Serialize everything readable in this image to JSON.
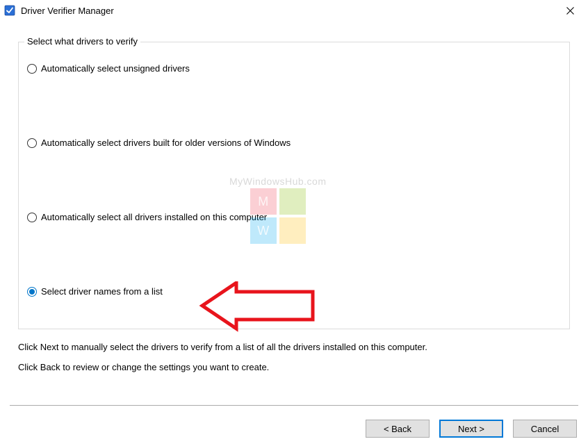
{
  "window": {
    "title": "Driver Verifier Manager"
  },
  "groupbox": {
    "title": "Select what drivers to verify",
    "options": [
      {
        "label": "Automatically select unsigned drivers",
        "selected": false
      },
      {
        "label": "Automatically select drivers built for older versions of Windows",
        "selected": false
      },
      {
        "label": "Automatically select all drivers installed on this computer",
        "selected": false
      },
      {
        "label": "Select driver names from a list",
        "selected": true
      }
    ]
  },
  "help": {
    "line1": "Click Next to manually select the drivers to verify from a list of all the drivers installed on this computer.",
    "line2": "Click Back to review or change the settings you want to create."
  },
  "buttons": {
    "back": "< Back",
    "next": "Next >",
    "cancel": "Cancel"
  },
  "watermark": {
    "text": "MyWindowsHub.com",
    "tiles": [
      "M",
      "",
      "W",
      ""
    ]
  }
}
